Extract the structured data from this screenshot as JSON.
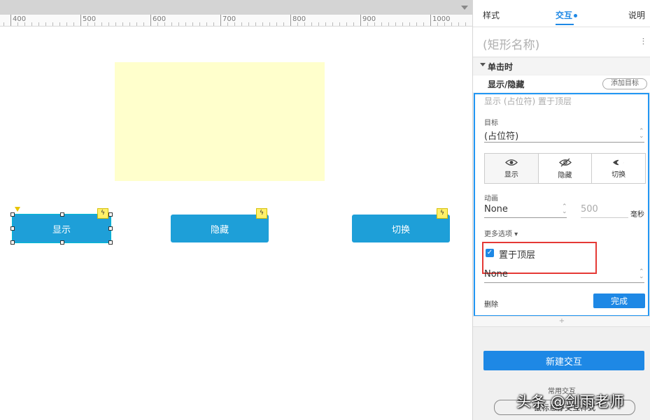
{
  "ruler": {
    "labels": [
      "400",
      "500",
      "600",
      "700",
      "800",
      "900",
      "1000"
    ]
  },
  "canvas": {
    "buttons": [
      {
        "label": "显示"
      },
      {
        "label": "隐藏"
      },
      {
        "label": "切换"
      }
    ],
    "bolt_glyph": "ϟ"
  },
  "panel": {
    "tabs": {
      "style": "样式",
      "interaction": "交互",
      "notes": "说明"
    },
    "name_placeholder": "(矩形名称)",
    "settings_glyph": "⫶",
    "event": {
      "title": "单击时"
    },
    "action": {
      "title": "显示/隐藏",
      "add_target": "添加目标"
    },
    "editor": {
      "summary": "显示 (占位符)  置于顶层",
      "target_label": "目标",
      "target_value": "(占位符)",
      "visibility": [
        {
          "label": "显示",
          "icon": "eye-icon"
        },
        {
          "label": "隐藏",
          "icon": "eye-off-icon"
        },
        {
          "label": "切换",
          "icon": "eye-toggle-icon"
        }
      ],
      "animation_label": "动画",
      "animation_value": "None",
      "duration_value": "500",
      "duration_unit": "毫秒",
      "more_options": "更多选项 ▾",
      "bring_to_front": {
        "label": "置于顶层",
        "checked": true,
        "check_glyph": "✓"
      },
      "layer_value": "None",
      "delete_label": "删除",
      "done_label": "完成"
    },
    "divider_glyph": "+",
    "new_interaction": "新建交互",
    "common_interactions": "常用交互",
    "hover_style": "鼠标悬停交互样式"
  },
  "watermark": "头条 @剑雨老师",
  "colors": {
    "accent": "#1e88e5",
    "button": "#1e9fd8",
    "placeholder_fill": "#ffffcc",
    "highlight": "#e53935"
  }
}
